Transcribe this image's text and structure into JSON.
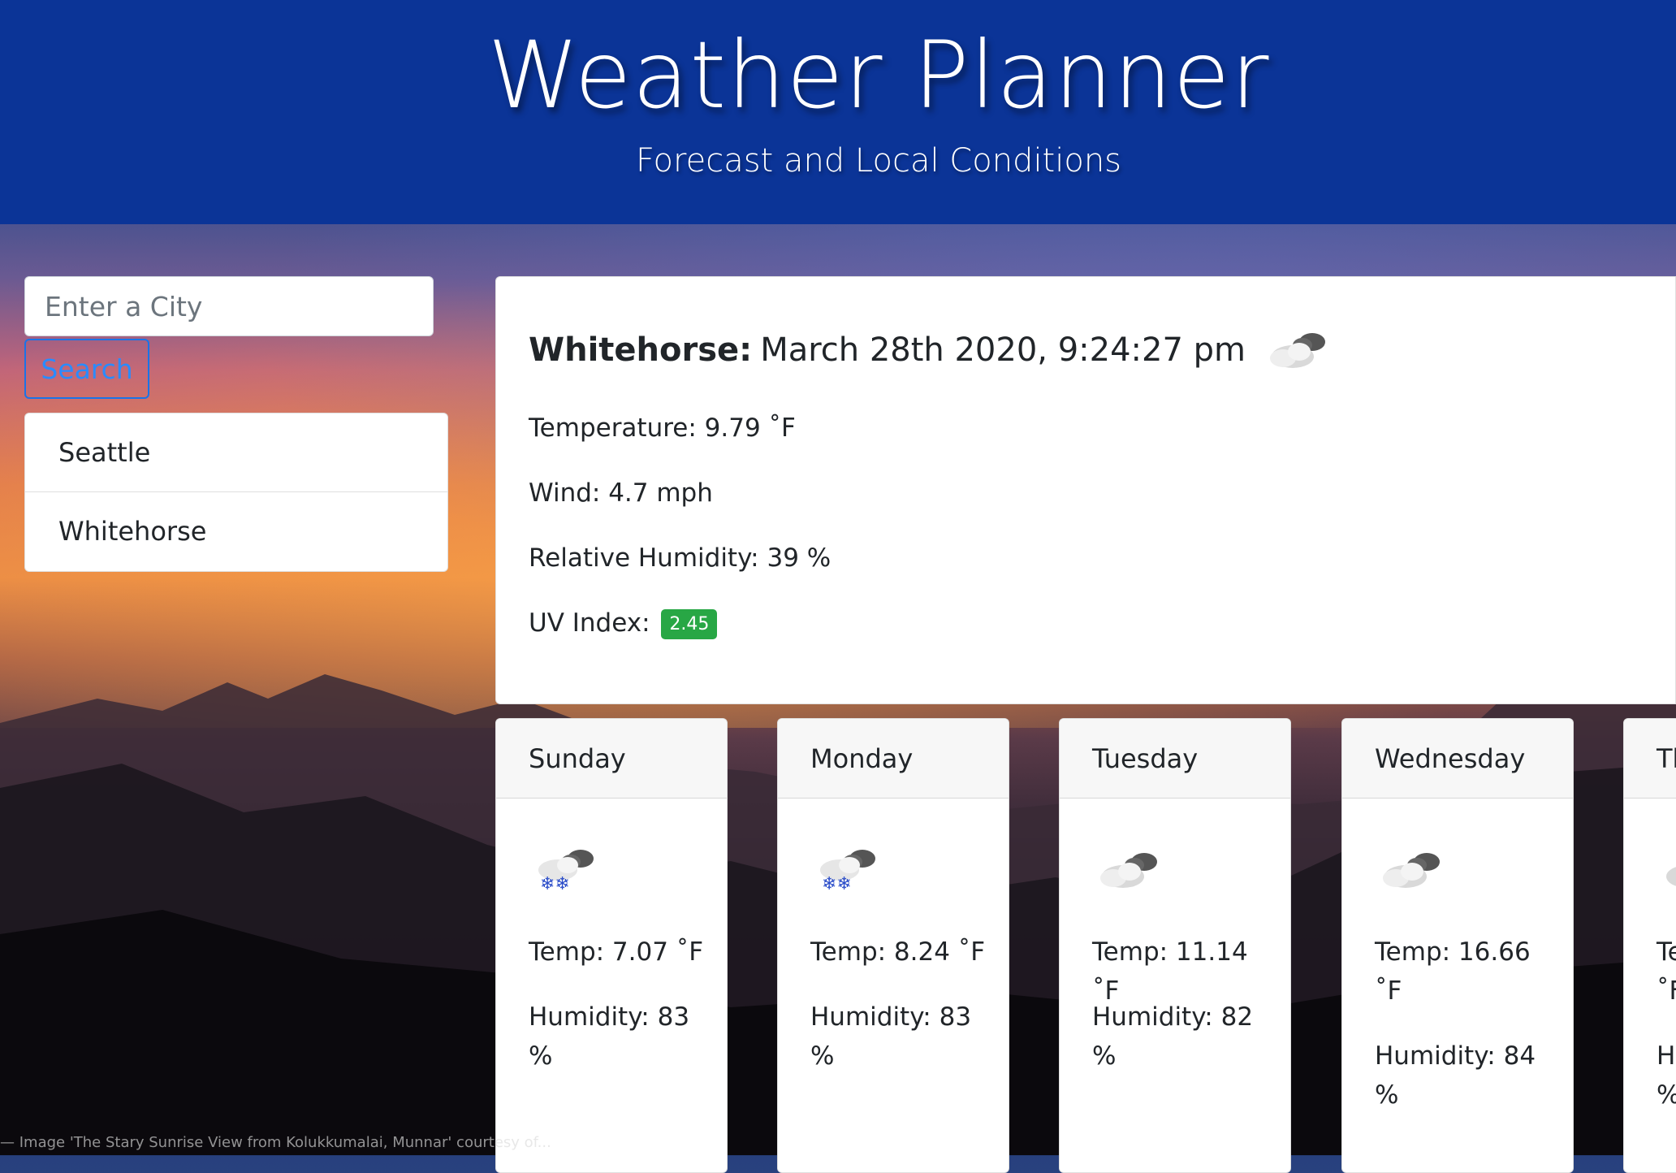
{
  "header": {
    "title": "Weather Planner",
    "subtitle": "Forecast and Local Conditions"
  },
  "search": {
    "placeholder": "Enter a City",
    "button_label": "Search"
  },
  "cities": [
    "Seattle",
    "Whitehorse"
  ],
  "current": {
    "city": "Whitehorse:",
    "datetime": "March 28th 2020, 9:24:27 pm",
    "icon": "cloudy-icon",
    "temperature": "Temperature: 9.79 ˚F",
    "wind": "Wind: 4.7 mph",
    "humidity": "Relative Humidity: 39 %",
    "uv_label": "UV Index:",
    "uv_value": "2.45"
  },
  "forecast": [
    {
      "day": "Sunday",
      "icon": "snow-cloud-icon",
      "temp": "Temp: 7.07 ˚F",
      "humidity": "Humidity: 83 %"
    },
    {
      "day": "Monday",
      "icon": "snow-cloud-icon",
      "temp": "Temp: 8.24 ˚F",
      "humidity": "Humidity: 83 %"
    },
    {
      "day": "Tuesday",
      "icon": "cloudy-icon",
      "temp": "Temp: 11.14 ˚F",
      "humidity": "Humidity: 82 %"
    },
    {
      "day": "Wednesday",
      "icon": "cloudy-icon",
      "temp": "Temp: 16.66 ˚F",
      "humidity": "Humidity: 84 %"
    },
    {
      "day": "Th",
      "icon": "cloudy-icon",
      "temp": "Te ˚F",
      "humidity": "H %"
    }
  ],
  "colors": {
    "header_bg": "#0b3497",
    "uv_badge": "#28a745",
    "search_button": "#1a73e8"
  },
  "footer": {
    "credit": "— Image 'The Stary Sunrise View from Kolukkumalai, Munnar' courtesy of..."
  }
}
